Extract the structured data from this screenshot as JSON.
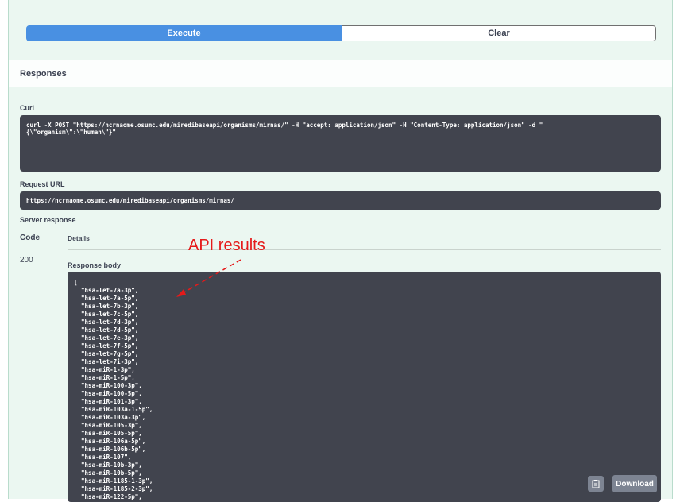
{
  "actions": {
    "execute_label": "Execute",
    "clear_label": "Clear"
  },
  "responses": {
    "title": "Responses",
    "curl_label": "Curl",
    "curl_command": "curl -X POST \"https://ncrnaome.osumc.edu/miredibaseapi/organisms/mirnas/\" -H \"accept: application/json\" -H \"Content-Type: application/json\" -d \"\n{\\\"organism\\\":\\\"human\\\"}\"",
    "request_url_label": "Request URL",
    "request_url": "https://ncrnaome.osumc.edu/miredibaseapi/organisms/mirnas/",
    "server_response_label": "Server response",
    "code_header": "Code",
    "details_header": "Details",
    "status_code": "200",
    "response_body_label": "Response body",
    "response_body": "[\n  \"hsa-let-7a-3p\",\n  \"hsa-let-7a-5p\",\n  \"hsa-let-7b-3p\",\n  \"hsa-let-7c-5p\",\n  \"hsa-let-7d-3p\",\n  \"hsa-let-7d-5p\",\n  \"hsa-let-7e-3p\",\n  \"hsa-let-7f-5p\",\n  \"hsa-let-7g-5p\",\n  \"hsa-let-7i-3p\",\n  \"hsa-miR-1-3p\",\n  \"hsa-miR-1-5p\",\n  \"hsa-miR-100-3p\",\n  \"hsa-miR-100-5p\",\n  \"hsa-miR-101-3p\",\n  \"hsa-miR-103a-1-5p\",\n  \"hsa-miR-103a-3p\",\n  \"hsa-miR-105-3p\",\n  \"hsa-miR-105-5p\",\n  \"hsa-miR-106a-5p\",\n  \"hsa-miR-106b-5p\",\n  \"hsa-miR-107\",\n  \"hsa-miR-10b-3p\",\n  \"hsa-miR-10b-5p\",\n  \"hsa-miR-1185-1-3p\",\n  \"hsa-miR-1185-2-3p\",\n  \"hsa-miR-122-5p\",",
    "download_label": "Download"
  },
  "annotation": {
    "text": "API results",
    "color": "#e51a1a"
  },
  "icons": {
    "copy": "clipboard-icon"
  },
  "colors": {
    "execute": "#4990e2",
    "panel": "#ebf7f1",
    "code_bg": "#41444e"
  }
}
